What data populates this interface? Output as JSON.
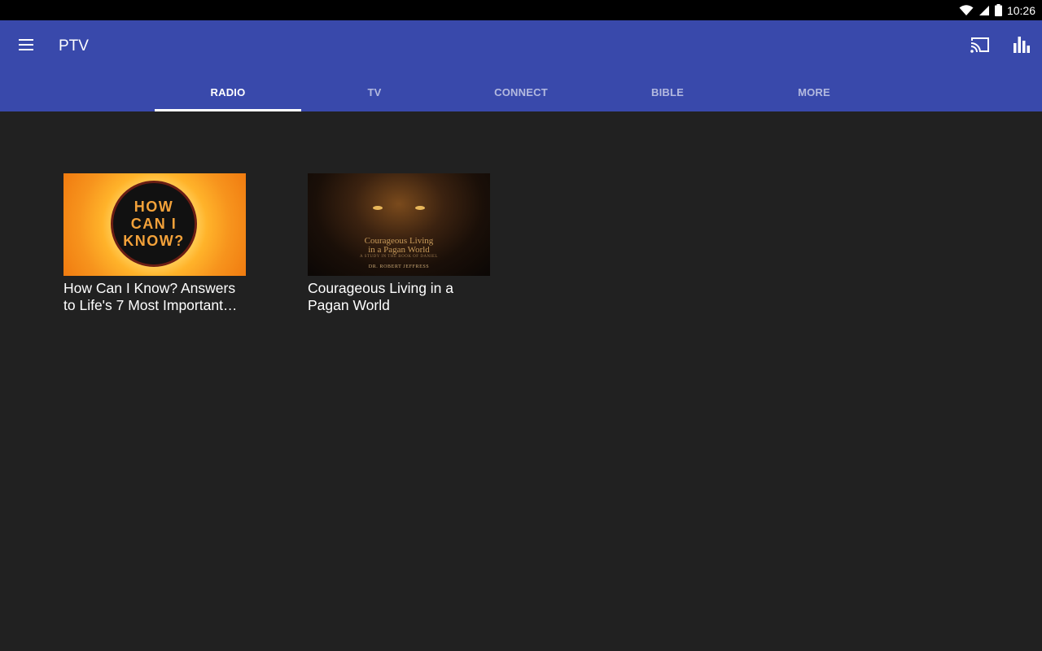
{
  "status_bar": {
    "time": "10:26",
    "icons": [
      "wifi-icon",
      "cell-signal-icon",
      "battery-icon"
    ]
  },
  "app_bar": {
    "title": "PTV",
    "color": "#3949ab",
    "menu_icon": "menu-icon",
    "actions": [
      "cast-icon",
      "stats-icon"
    ]
  },
  "tabs": [
    {
      "label": "RADIO",
      "active": true
    },
    {
      "label": "TV",
      "active": false
    },
    {
      "label": "CONNECT",
      "active": false
    },
    {
      "label": "BIBLE",
      "active": false
    },
    {
      "label": "MORE",
      "active": false
    }
  ],
  "items": [
    {
      "title": "How Can I Know? Answers to Life's 7 Most Important…",
      "thumbnail_text": "HOW\nCAN I\nKNOW?"
    },
    {
      "title": "Courageous Living in a Pagan World",
      "thumbnail_title_line1": "Courageous Living",
      "thumbnail_title_line2": "in a Pagan World",
      "thumbnail_subtitle": "A STUDY IN THE BOOK OF DANIEL",
      "thumbnail_author": "DR. ROBERT JEFFRESS"
    }
  ]
}
